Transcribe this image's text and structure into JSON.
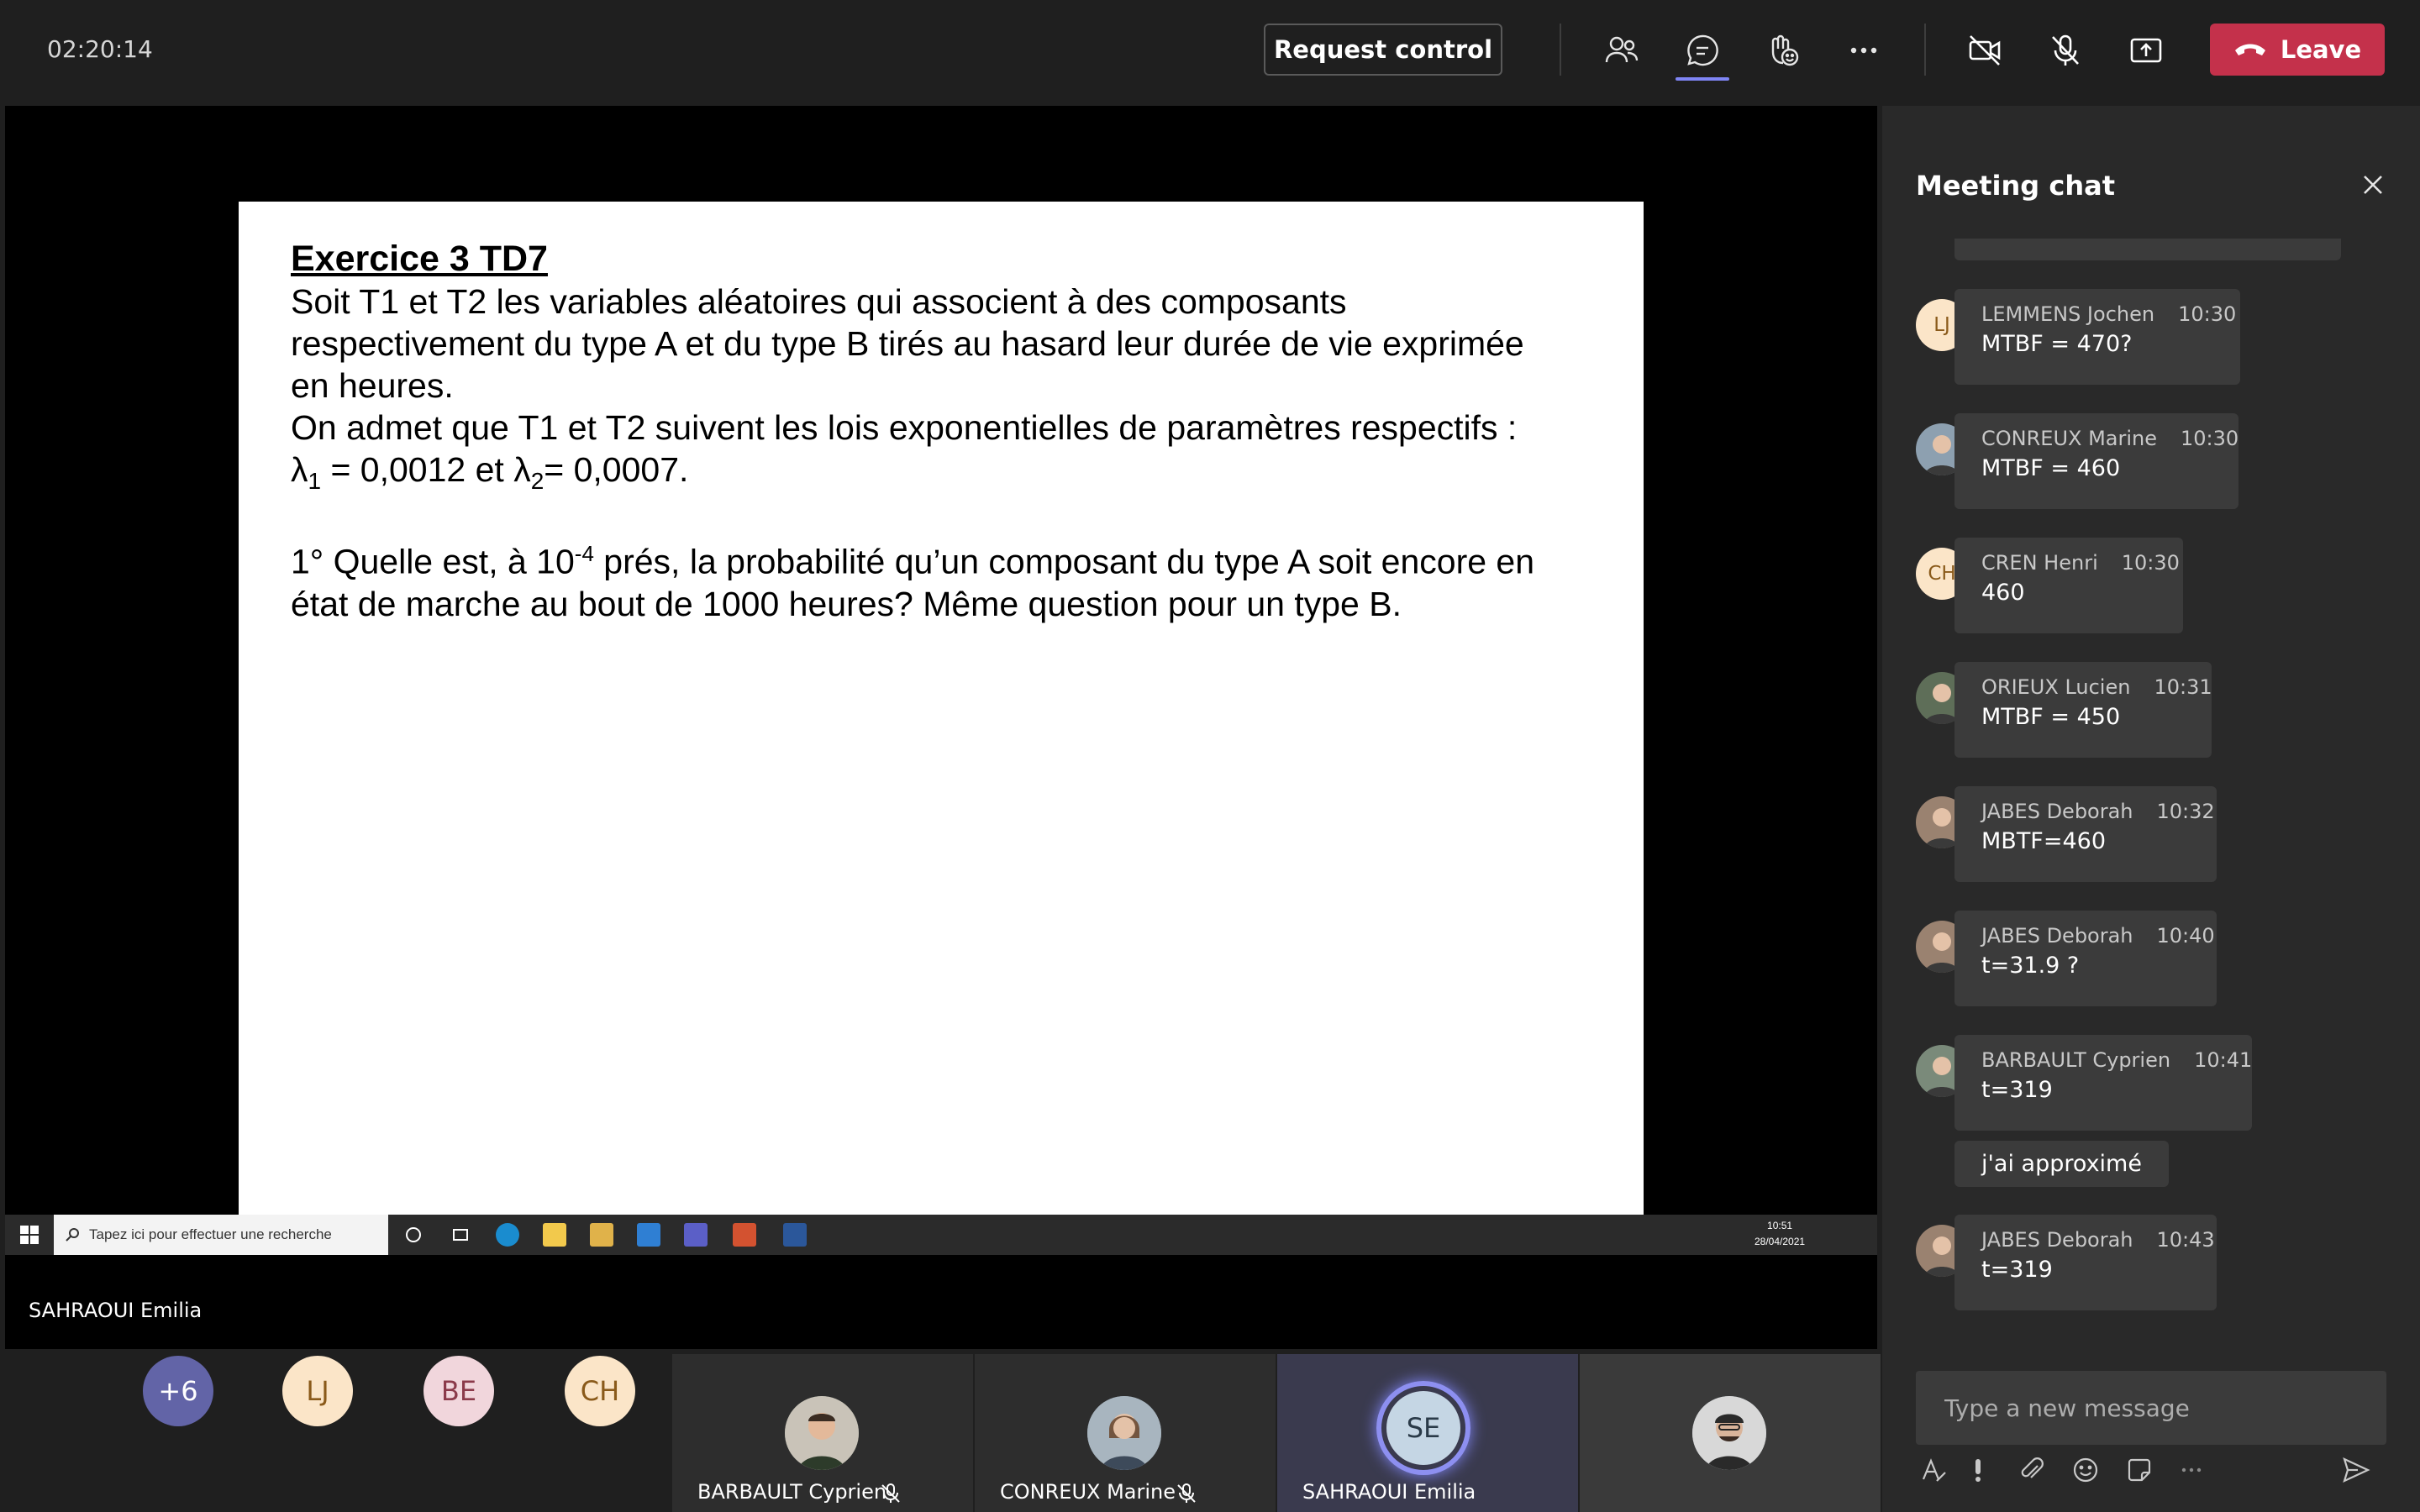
{
  "topbar": {
    "timer": "02:20:14",
    "request_control_label": "Request control",
    "leave_label": "Leave",
    "icons": [
      "people-icon",
      "chat-icon",
      "reactions-icon",
      "more-icon",
      "camera-off-icon",
      "mic-off-icon",
      "share-icon",
      "phone-icon"
    ]
  },
  "slide": {
    "title": "Exercice 3 TD7",
    "para1_line1": "Soit T1 et T2 les variables aléatoires qui associent à des composants",
    "para1_line2": "respectivement du type A et du type B tirés au hasard leur durée de vie exprimée",
    "para1_line3": "en heures.",
    "para2_line1": "On admet que T1 et T2 suivent les lois exponentielles de paramètres respectifs :",
    "lambda1_sym": "λ",
    "lambda1_sub": "1",
    "lambda1_val": " = 0,0012 et ",
    "lambda2_sym": "λ",
    "lambda2_sub": "2",
    "lambda2_val": "= 0,0007.",
    "q1_part1": "1° Quelle est, à 10",
    "q1_exp": "-4",
    "q1_part2": " prés, la probabilité qu’un composant du type A soit encore en",
    "q1_line2": "état de marche au bout de 1000 heures? Même question pour un type B."
  },
  "taskbar": {
    "search_placeholder": "Tapez ici pour effectuer une recherche",
    "clock_time": "10:51",
    "clock_date": "28/04/2021"
  },
  "presenter": {
    "name": "SAHRAOUI Emilia"
  },
  "chat": {
    "title": "Meeting chat",
    "messages": [
      {
        "initials": "LJ",
        "name": "LEMMENS Jochen",
        "time": "10:30",
        "text": "MTBF = 470?"
      },
      {
        "initials": "",
        "name": "CONREUX Marine",
        "time": "10:30",
        "text": "MTBF = 460"
      },
      {
        "initials": "CH",
        "name": "CREN Henri",
        "time": "10:30",
        "text": "460"
      },
      {
        "initials": "",
        "name": "ORIEUX Lucien",
        "time": "10:31",
        "text": "MTBF = 450"
      },
      {
        "initials": "",
        "name": "JABES Deborah",
        "time": "10:32",
        "text": "MBTF=460"
      },
      {
        "initials": "",
        "name": "JABES Deborah",
        "time": "10:40",
        "text": "t=31.9 ?"
      },
      {
        "initials": "",
        "name": "BARBAULT Cyprien",
        "time": "10:41",
        "text": "t=319"
      },
      {
        "initials": "",
        "name": "JABES Deborah",
        "time": "10:43",
        "text": "t=319"
      }
    ],
    "followup_text": "j'ai approximé",
    "compose_placeholder": "Type a new message"
  },
  "participants": {
    "overflow": "+6",
    "circles": [
      "LJ",
      "BE",
      "CH"
    ],
    "tiles": [
      {
        "name": "BARBAULT Cyprien"
      },
      {
        "name": "CONREUX Marine"
      },
      {
        "name": "SAHRAOUI Emilia",
        "initials": "SE"
      },
      {
        "name": ""
      }
    ]
  },
  "colors": {
    "leave": "#c4314b",
    "accent": "#7f85f5",
    "overflow_circle": "#6264a7",
    "circle_lj": "#fbe5c8",
    "circle_be": "#f1d6dc",
    "circle_ch": "#fbe5c8"
  }
}
